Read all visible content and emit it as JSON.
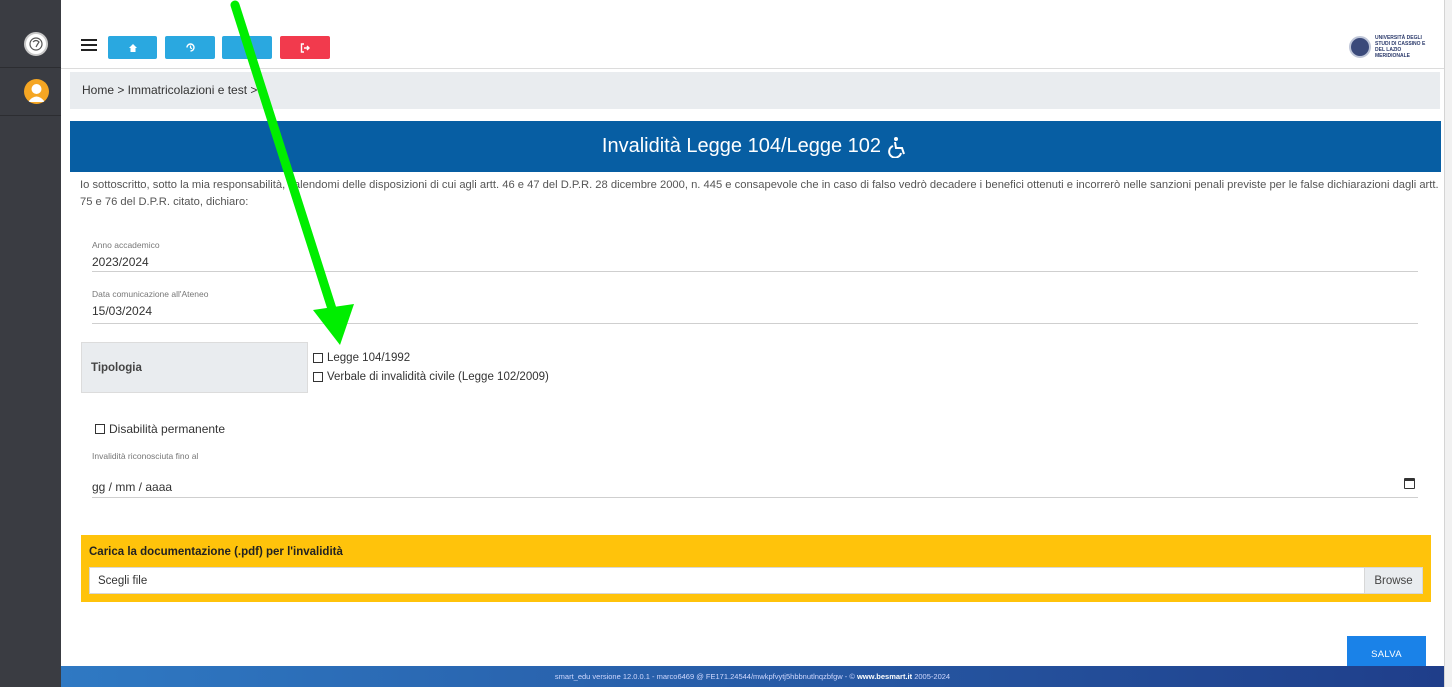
{
  "topbar": {
    "buttons": [
      {
        "name": "home",
        "icon": "home-icon"
      },
      {
        "name": "history",
        "icon": "history-icon"
      },
      {
        "name": "third",
        "icon": "blank"
      },
      {
        "name": "logout",
        "icon": "logout-icon"
      }
    ],
    "university": "UNIVERSITÀ DEGLI STUDI DI CASSINO E DEL LAZIO MERIDIONALE"
  },
  "breadcrumb": "Home > Immatricolazioni e test >",
  "header": {
    "title": "Invalidità Legge 104/Legge 102",
    "icon": "wheelchair-icon",
    "color": "#075ea3"
  },
  "declaration": "Io sottoscritto, sotto la mia responsabilità, valendomi delle disposizioni di cui agli artt. 46 e 47 del D.P.R. 28 dicembre 2000, n. 445 e consapevole che in caso di falso vedrò decadere i benefici ottenuti e incorrerò nelle sanzioni penali previste per le false dichiarazioni dagli artt. 75 e 76 del D.P.R. citato, dichiaro:",
  "fields": {
    "anno_label": "Anno accademico",
    "anno_value": "2023/2024",
    "data_label": "Data comunicazione all'Ateneo",
    "data_value": "15/03/2024",
    "invalid_label": "Invalidità riconosciuta fino al",
    "invalid_placeholder": "gg / mm / aaaa"
  },
  "tipologia": {
    "label": "Tipologia",
    "options": [
      "Legge 104/1992",
      "Verbale di invalidità civile (Legge 102/2009)"
    ]
  },
  "permanent_label": "Disabilità permanente",
  "upload": {
    "label": "Carica la documentazione (.pdf) per l'invalidità",
    "placeholder": "Scegli file",
    "browse": "Browse",
    "color": "#ffc30b"
  },
  "save_label": "SALVA",
  "footer": {
    "text": "smart_edu versione 12.0.0.1 - marco6469 @ FE171.24544/mwkpfvytj5hbbnutlnqzbfgw - ©",
    "link": "www.besmart.it",
    "years": "2005-2024"
  },
  "annotation_color": "#00ee00"
}
